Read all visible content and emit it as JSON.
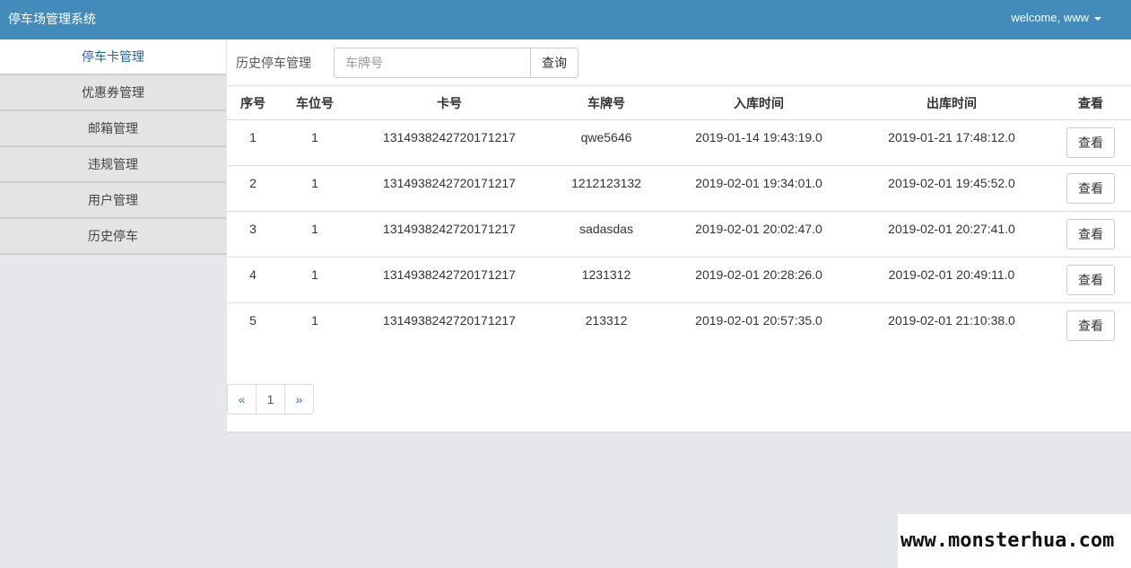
{
  "app": {
    "title": "停车场管理系统",
    "user_label": "welcome, www"
  },
  "sidebar": {
    "items": [
      {
        "label": "停车卡管理"
      },
      {
        "label": "优惠券管理"
      },
      {
        "label": "邮箱管理"
      },
      {
        "label": "违规管理"
      },
      {
        "label": "用户管理"
      },
      {
        "label": "历史停车"
      }
    ],
    "active_index": 0
  },
  "main": {
    "title": "历史停车管理",
    "search": {
      "value": "",
      "placeholder": "车牌号",
      "button_label": "查询"
    }
  },
  "table": {
    "headers": [
      "序号",
      "车位号",
      "卡号",
      "车牌号",
      "入库时间",
      "出库时间",
      "查看"
    ],
    "rows": [
      {
        "no": "1",
        "spot": "1",
        "card": "1314938242720171217",
        "plate": "qwe5646",
        "in": "2019-01-14 19:43:19.0",
        "out": "2019-01-21 17:48:12.0",
        "action": "查看"
      },
      {
        "no": "2",
        "spot": "1",
        "card": "1314938242720171217",
        "plate": "1212123132",
        "in": "2019-02-01 19:34:01.0",
        "out": "2019-02-01 19:45:52.0",
        "action": "查看"
      },
      {
        "no": "3",
        "spot": "1",
        "card": "1314938242720171217",
        "plate": "sadasdas",
        "in": "2019-02-01 20:02:47.0",
        "out": "2019-02-01 20:27:41.0",
        "action": "查看"
      },
      {
        "no": "4",
        "spot": "1",
        "card": "1314938242720171217",
        "plate": "1231312",
        "in": "2019-02-01 20:28:26.0",
        "out": "2019-02-01 20:49:11.0",
        "action": "查看"
      },
      {
        "no": "5",
        "spot": "1",
        "card": "1314938242720171217",
        "plate": "213312",
        "in": "2019-02-01 20:57:35.0",
        "out": "2019-02-01 21:10:38.0",
        "action": "查看"
      }
    ]
  },
  "pagination": {
    "prev": "«",
    "pages": [
      "1"
    ],
    "next": "»"
  },
  "watermark": "www.monsterhua.com",
  "colors": {
    "header_bg": "#428bba",
    "page_bg": "#e6e7ea",
    "active_link": "#2a6496"
  }
}
